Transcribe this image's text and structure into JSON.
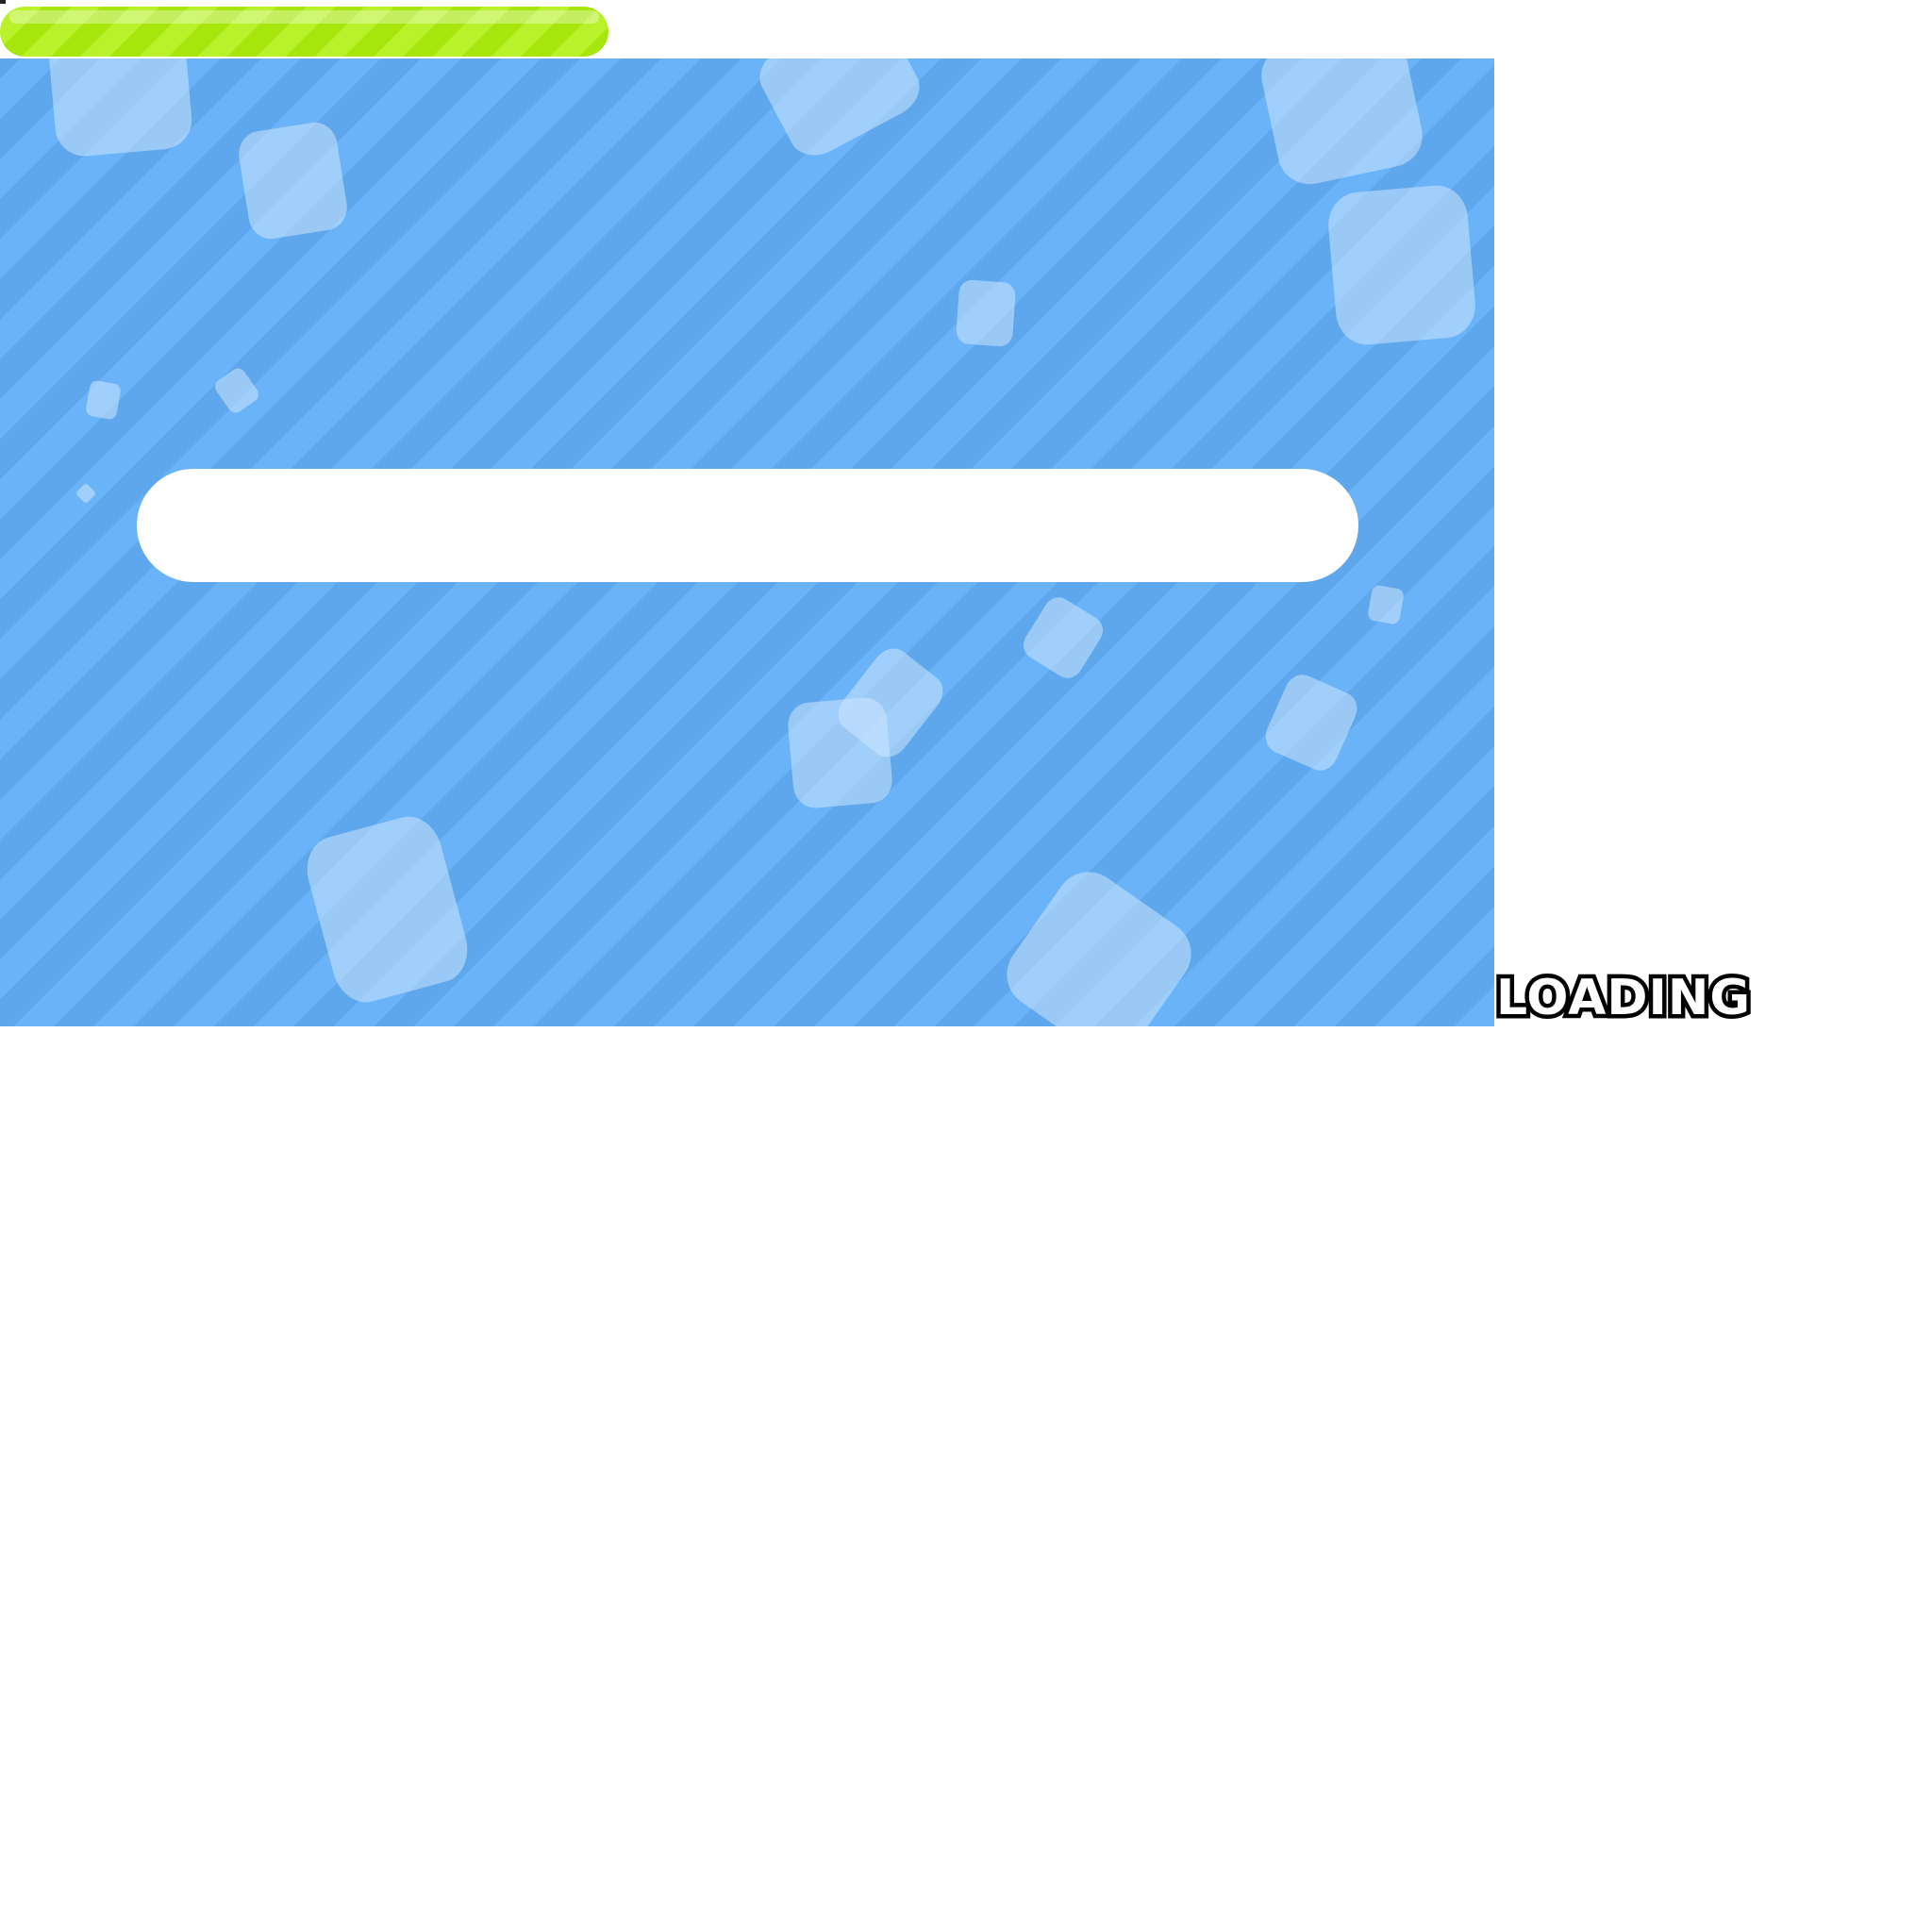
{
  "loading": {
    "label": "LOADING",
    "progress": 0
  },
  "colors": {
    "panel_blue_light": "#6bb3f8",
    "panel_blue_dark": "#5ea7ec",
    "bar_green": "#a6e60d",
    "track_white": "#ffffff",
    "text_outline": "#000000"
  }
}
